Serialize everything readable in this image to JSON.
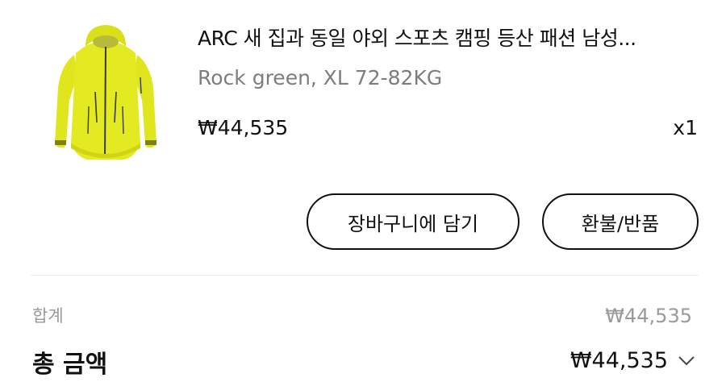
{
  "product": {
    "title": "ARC 새 집과 동일 야외 스포츠 캠핑 등산 패션 남성...",
    "option": "Rock green, XL  72-82KG",
    "price": "₩44,535",
    "quantity": "x1",
    "image_icon": "jacket-image",
    "image_color": "#e1e81f"
  },
  "actions": {
    "add_to_cart": "장바구니에 담기",
    "refund": "환불/반품"
  },
  "summary": {
    "subtotal_label": "합계",
    "subtotal_value": "₩44,535",
    "total_label": "총 금액",
    "total_value": "₩44,535",
    "expand_icon": "chevron-down-icon"
  }
}
